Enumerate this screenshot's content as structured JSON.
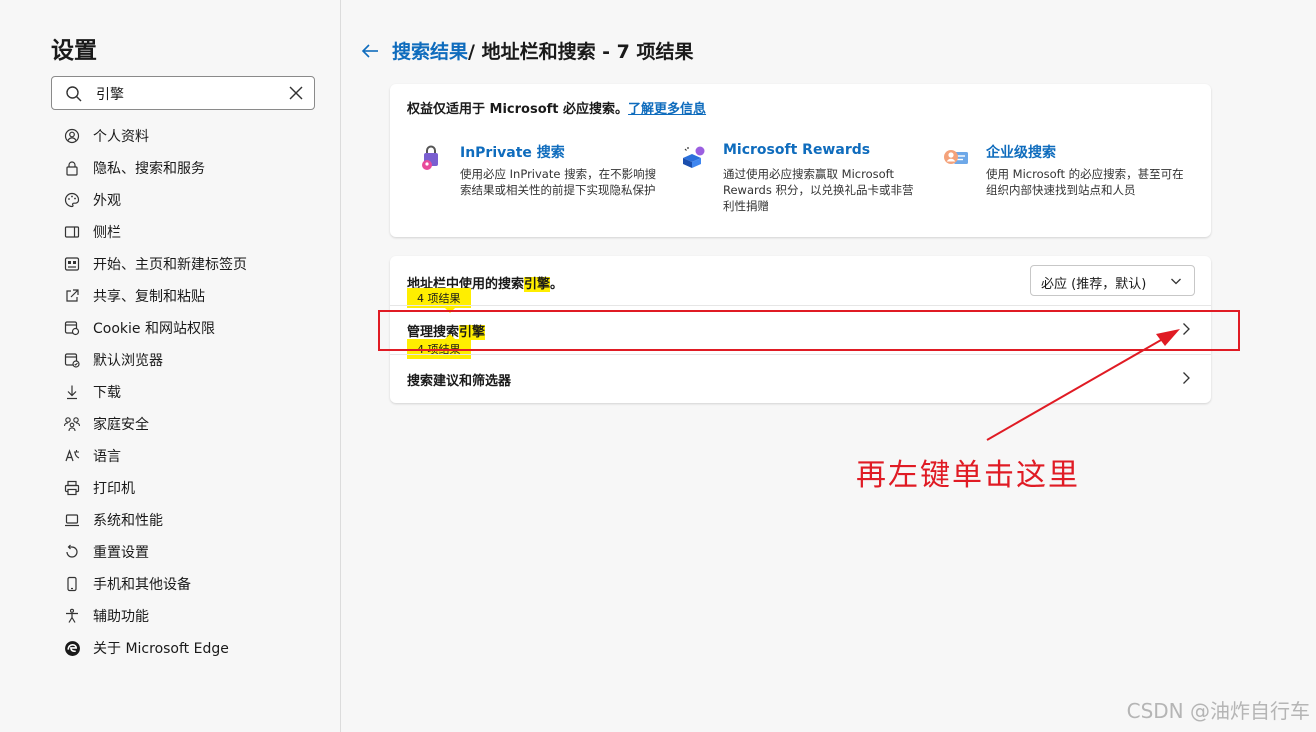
{
  "sidebar": {
    "title": "设置",
    "search": {
      "value": "引擎"
    },
    "items": [
      {
        "label": "个人资料",
        "icon": "profile-icon"
      },
      {
        "label": "隐私、搜索和服务",
        "icon": "lock-icon"
      },
      {
        "label": "外观",
        "icon": "palette-icon"
      },
      {
        "label": "侧栏",
        "icon": "sidebar-icon"
      },
      {
        "label": "开始、主页和新建标签页",
        "icon": "home-icon"
      },
      {
        "label": "共享、复制和粘贴",
        "icon": "share-icon"
      },
      {
        "label": "Cookie 和网站权限",
        "icon": "cookie-icon"
      },
      {
        "label": "默认浏览器",
        "icon": "browser-icon"
      },
      {
        "label": "下载",
        "icon": "download-icon"
      },
      {
        "label": "家庭安全",
        "icon": "family-icon"
      },
      {
        "label": "语言",
        "icon": "language-icon"
      },
      {
        "label": "打印机",
        "icon": "printer-icon"
      },
      {
        "label": "系统和性能",
        "icon": "system-icon"
      },
      {
        "label": "重置设置",
        "icon": "reset-icon"
      },
      {
        "label": "手机和其他设备",
        "icon": "phone-icon"
      },
      {
        "label": "辅助功能",
        "icon": "accessibility-icon"
      },
      {
        "label": "关于 Microsoft Edge",
        "icon": "edge-icon"
      }
    ]
  },
  "main": {
    "breadcrumb": {
      "link": "搜索结果",
      "rest": " / 地址栏和搜索 - 7 项结果"
    },
    "notice": {
      "text": "权益仅适用于 Microsoft 必应搜索。",
      "link": "了解更多信息"
    },
    "features": [
      {
        "title": "InPrivate 搜索",
        "desc": "使用必应 InPrivate 搜索，在不影响搜索结果或相关性的前提下实现隐私保护",
        "icon": "inprivate-icon"
      },
      {
        "title": "Microsoft Rewards",
        "desc": "通过使用必应搜索赢取 Microsoft Rewards 积分，以兑换礼品卡或非营利性捐赠",
        "icon": "rewards-icon"
      },
      {
        "title": "企业级搜索",
        "desc": "使用 Microsoft 的必应搜索，甚至可在组织内部快速找到站点和人员",
        "icon": "enterprise-icon"
      }
    ],
    "engine_row": {
      "label_pre": "地址栏中使用的搜索",
      "label_hl": "引擎",
      "label_post": "。",
      "select_value": "必应 (推荐，默认)",
      "tip": "4 项结果"
    },
    "manage_row": {
      "label_pre": "管理搜索",
      "label_hl": "引擎",
      "tip": "4 项结果"
    },
    "suggest_row": {
      "label": "搜索建议和筛选器"
    }
  },
  "annotation": {
    "text": "再左键单击这里",
    "color": "#e01b24"
  },
  "watermark": "CSDN @油炸自行车",
  "colors": {
    "accent": "#0f6cbd",
    "highlight": "#ffee00",
    "annotation": "#e01b24"
  }
}
